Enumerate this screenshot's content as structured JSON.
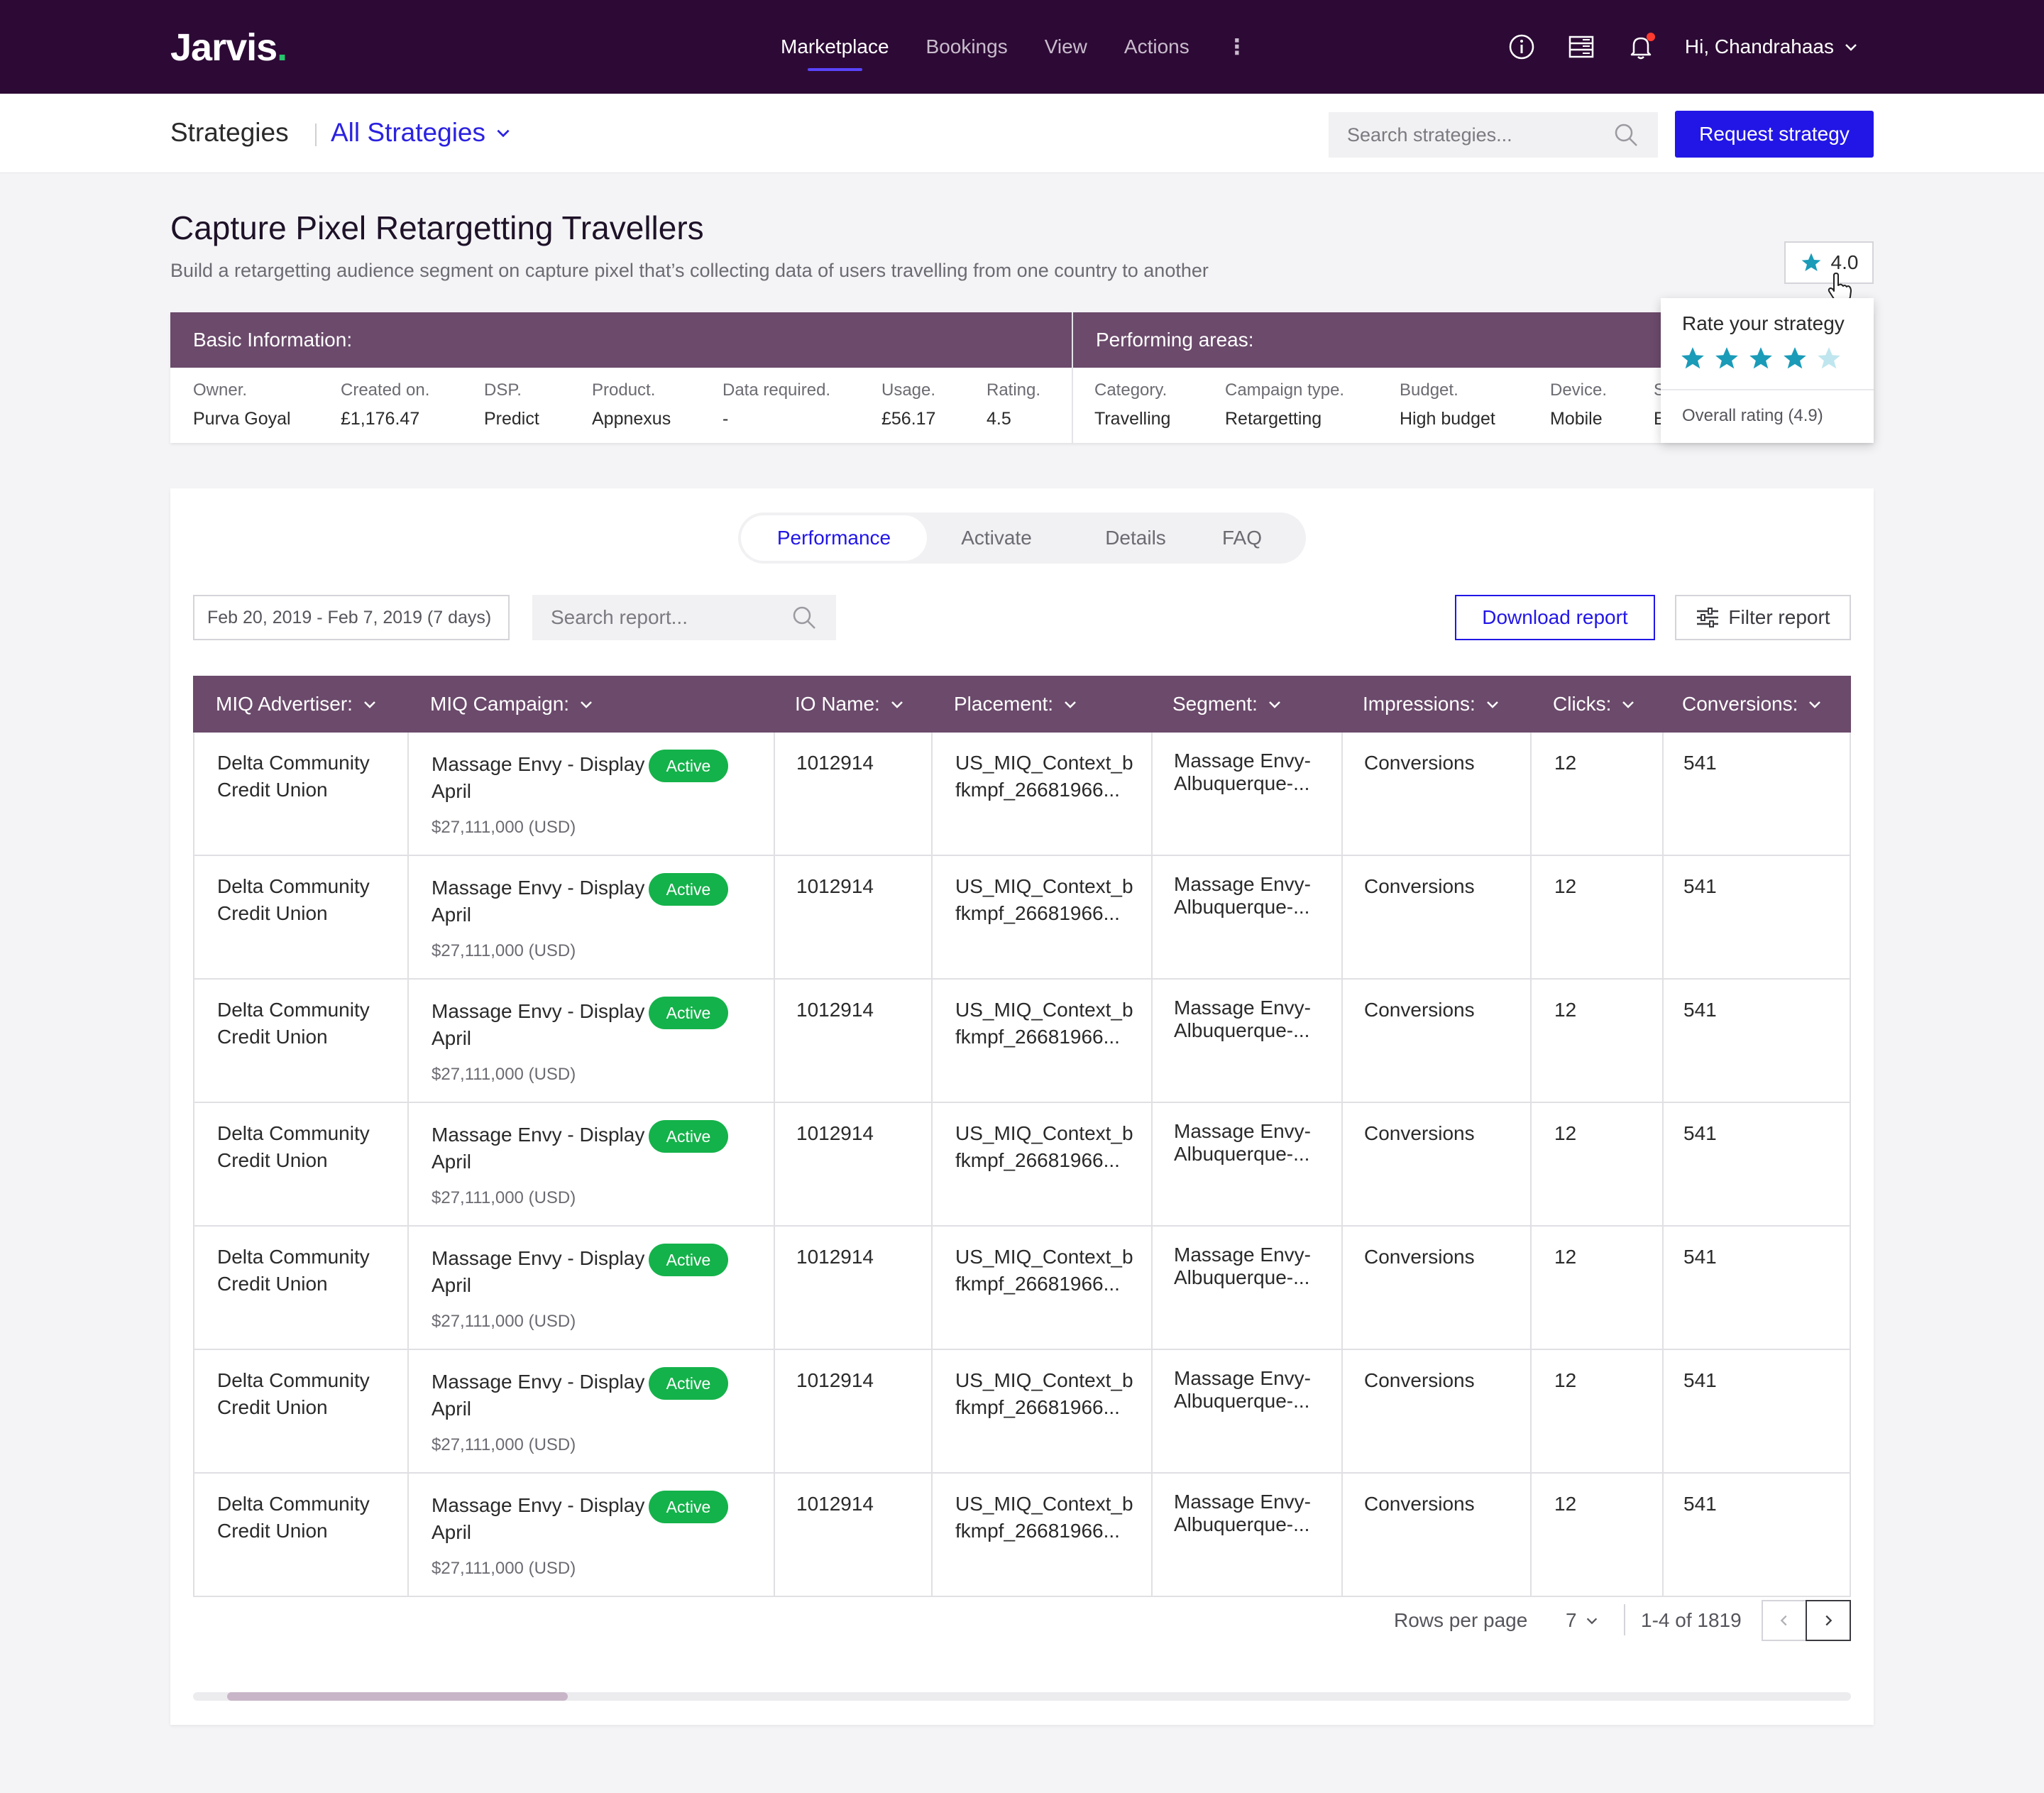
{
  "nav": {
    "logo": "Jarvis",
    "logo_dot": ".",
    "links": [
      "Marketplace",
      "Bookings",
      "View",
      "Actions"
    ],
    "greeting": "Hi, Chandrahaas"
  },
  "subheader": {
    "title": "Strategies",
    "filter": "All Strategies",
    "search_placeholder": "Search strategies...",
    "request_button": "Request strategy"
  },
  "strategy": {
    "title": "Capture Pixel Retargetting Travellers",
    "description": "Build a retargetting audience segment on capture pixel that’s collecting data of users travelling from one country to another",
    "rating": "4.0"
  },
  "basic_info": {
    "heading": "Basic Information:",
    "fields": [
      {
        "label": "Owner.",
        "value": "Purva Goyal"
      },
      {
        "label": "Created on.",
        "value": "£1,176.47"
      },
      {
        "label": "DSP.",
        "value": "Predict"
      },
      {
        "label": "Product.",
        "value": "Appnexus"
      },
      {
        "label": "Data required.",
        "value": "-"
      },
      {
        "label": "Usage.",
        "value": "£56.17"
      },
      {
        "label": "Rating.",
        "value": "4.5"
      }
    ]
  },
  "performing_areas": {
    "heading": "Performing areas:",
    "fields": [
      {
        "label": "Category.",
        "value": "Travelling"
      },
      {
        "label": "Campaign type.",
        "value": "Retargetting"
      },
      {
        "label": "Budget.",
        "value": "High budget"
      },
      {
        "label": "Device.",
        "value": "Mobile"
      },
      {
        "label": "S",
        "value": "E"
      }
    ]
  },
  "rate_popover": {
    "title": "Rate your strategy",
    "stars_filled": 4,
    "stars_total": 5,
    "overall": "Overall rating (4.9)"
  },
  "tabs": [
    "Performance",
    "Activate",
    "Details",
    "FAQ"
  ],
  "report": {
    "date_range": "Feb 20, 2019 - Feb 7, 2019 (7 days)",
    "search_placeholder": "Search report...",
    "download_button": "Download report",
    "filter_button": "Filter report"
  },
  "table": {
    "columns": [
      "MIQ Advertiser:",
      "MIQ Campaign:",
      "IO Name:",
      "Placement:",
      "Segment:",
      "Impressions:",
      "Clicks:",
      "Conversions:"
    ],
    "rows": [
      {
        "advertiser_1": "Delta Community",
        "advertiser_2": "Credit Union",
        "campaign_1": "Massage Envy - Display",
        "campaign_2": "April",
        "budget": "$27,111,000 (USD)",
        "status": "Active",
        "io": "1012914",
        "placement_1": "US_MIQ_Context_b",
        "placement_2": "fkmpf_26681966...",
        "segment_1": "Massage Envy-",
        "segment_2": "Albuquerque-...",
        "impressions": "Conversions",
        "clicks": "12",
        "conversions": "541"
      },
      {
        "advertiser_1": "Delta Community",
        "advertiser_2": "Credit Union",
        "campaign_1": "Massage Envy - Display",
        "campaign_2": "April",
        "budget": "$27,111,000 (USD)",
        "status": "Active",
        "io": "1012914",
        "placement_1": "US_MIQ_Context_b",
        "placement_2": "fkmpf_26681966...",
        "segment_1": "Massage Envy-",
        "segment_2": "Albuquerque-...",
        "impressions": "Conversions",
        "clicks": "12",
        "conversions": "541"
      },
      {
        "advertiser_1": "Delta Community",
        "advertiser_2": "Credit Union",
        "campaign_1": "Massage Envy - Display",
        "campaign_2": "April",
        "budget": "$27,111,000 (USD)",
        "status": "Active",
        "io": "1012914",
        "placement_1": "US_MIQ_Context_b",
        "placement_2": "fkmpf_26681966...",
        "segment_1": "Massage Envy-",
        "segment_2": "Albuquerque-...",
        "impressions": "Conversions",
        "clicks": "12",
        "conversions": "541"
      },
      {
        "advertiser_1": "Delta Community",
        "advertiser_2": "Credit Union",
        "campaign_1": "Massage Envy - Display",
        "campaign_2": "April",
        "budget": "$27,111,000 (USD)",
        "status": "Active",
        "io": "1012914",
        "placement_1": "US_MIQ_Context_b",
        "placement_2": "fkmpf_26681966...",
        "segment_1": "Massage Envy-",
        "segment_2": "Albuquerque-...",
        "impressions": "Conversions",
        "clicks": "12",
        "conversions": "541"
      },
      {
        "advertiser_1": "Delta Community",
        "advertiser_2": "Credit Union",
        "campaign_1": "Massage Envy - Display",
        "campaign_2": "April",
        "budget": "$27,111,000 (USD)",
        "status": "Active",
        "io": "1012914",
        "placement_1": "US_MIQ_Context_b",
        "placement_2": "fkmpf_26681966...",
        "segment_1": "Massage Envy-",
        "segment_2": "Albuquerque-...",
        "impressions": "Conversions",
        "clicks": "12",
        "conversions": "541"
      },
      {
        "advertiser_1": "Delta Community",
        "advertiser_2": "Credit Union",
        "campaign_1": "Massage Envy - Display",
        "campaign_2": "April",
        "budget": "$27,111,000 (USD)",
        "status": "Active",
        "io": "1012914",
        "placement_1": "US_MIQ_Context_b",
        "placement_2": "fkmpf_26681966...",
        "segment_1": "Massage Envy-",
        "segment_2": "Albuquerque-...",
        "impressions": "Conversions",
        "clicks": "12",
        "conversions": "541"
      },
      {
        "advertiser_1": "Delta Community",
        "advertiser_2": "Credit Union",
        "campaign_1": "Massage Envy - Display",
        "campaign_2": "April",
        "budget": "$27,111,000 (USD)",
        "status": "Active",
        "io": "1012914",
        "placement_1": "US_MIQ_Context_b",
        "placement_2": "fkmpf_26681966...",
        "segment_1": "Massage Envy-",
        "segment_2": "Albuquerque-...",
        "impressions": "Conversions",
        "clicks": "12",
        "conversions": "541"
      }
    ]
  },
  "pagination": {
    "rows_per_page_label": "Rows per page",
    "rows_per_page": "7",
    "range": "1-4 of 1819"
  },
  "colors": {
    "nav_bg": "#2d0a35",
    "accent": "#2216e6",
    "header_purple": "#6b4a6b",
    "active_green": "#14b24a",
    "star_teal": "#1a9bb8"
  }
}
